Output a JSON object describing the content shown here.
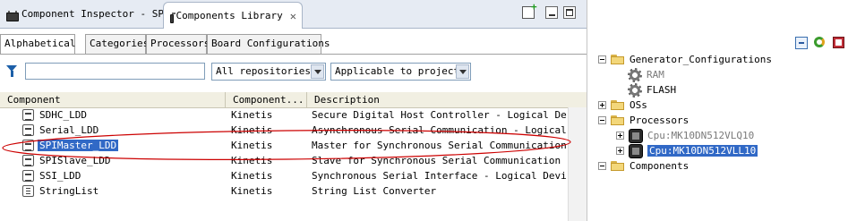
{
  "tabs": [
    {
      "label": "Component Inspector - SPI",
      "icon": "chip-icon",
      "active": false
    },
    {
      "label": "Components Library",
      "icon": "chip-icon",
      "active": true,
      "close_icon": "close-icon"
    }
  ],
  "view_toolbar": {
    "icons": [
      "new-item-icon",
      "minimize-icon",
      "maximize-icon"
    ]
  },
  "subtabs": [
    {
      "label": "Alphabetical",
      "active": true
    },
    {
      "label": "Categories"
    },
    {
      "label": "Processors"
    },
    {
      "label": "Board Configurations"
    }
  ],
  "filter": {
    "icon": "filter-icon",
    "value": ""
  },
  "repository_select": {
    "value": "All repositories"
  },
  "applicability_select": {
    "value": "Applicable to project"
  },
  "table": {
    "columns": [
      "Component",
      "Component...",
      "Description"
    ],
    "rows": [
      {
        "name": "SDHC_LDD",
        "vendor": "Kinetis",
        "description": "Secure Digital Host Controller - Logical Device"
      },
      {
        "name": "Serial_LDD",
        "vendor": "Kinetis",
        "description": "Asynchronous Serial Communication - Logical Devi"
      },
      {
        "name": "SPIMaster_LDD",
        "vendor": "Kinetis",
        "description": "Master for Synchronous Serial Communication - Lo",
        "selected": true
      },
      {
        "name": "SPISlave_LDD",
        "vendor": "Kinetis",
        "description": "Slave for Synchronous Serial Communication - Log"
      },
      {
        "name": "SSI_LDD",
        "vendor": "Kinetis",
        "description": "Synchronous Serial Interface - Logical Device Dr"
      },
      {
        "name": "StringList",
        "vendor": "Kinetis",
        "description": "String List Converter"
      }
    ]
  },
  "annotation": {
    "color": "#cc0000",
    "shape": "ellipse"
  },
  "right_toolbar": {
    "icons": [
      "collapse-all-icon",
      "refresh-icon",
      "settings-icon"
    ]
  },
  "tree": [
    {
      "label": "Generator_Configurations",
      "expanded": true,
      "level": 0,
      "icon": "folder-icon",
      "children": [
        {
          "label": "RAM",
          "icon": "gear-icon",
          "greyed": true
        },
        {
          "label": "FLASH",
          "icon": "gear-icon"
        }
      ]
    },
    {
      "label": "OSs",
      "expanded": false,
      "icon": "folder-icon"
    },
    {
      "label": "Processors",
      "expanded": true,
      "icon": "folder-icon",
      "children": [
        {
          "label": "Cpu:MK10DN512VLQ10",
          "icon": "cpu-icon",
          "greyed": true
        },
        {
          "label": "Cpu:MK10DN512VLL10",
          "icon": "cpu-icon",
          "selected": true
        }
      ]
    },
    {
      "label": "Components",
      "expanded": true,
      "icon": "folder-icon"
    }
  ]
}
